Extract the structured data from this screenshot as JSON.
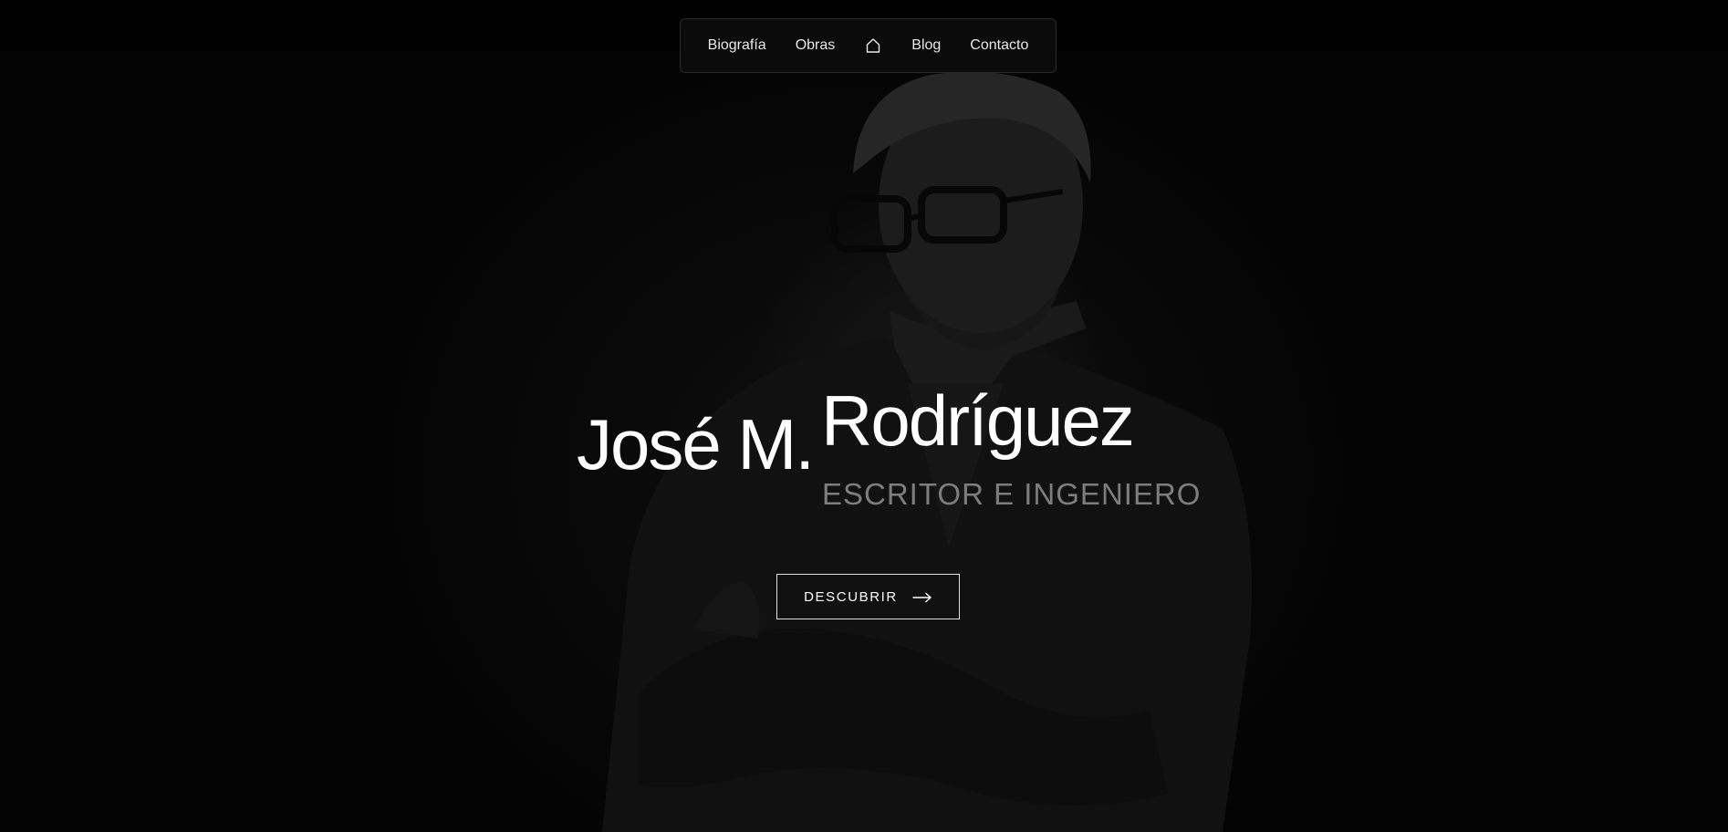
{
  "nav": {
    "items": [
      {
        "label": "Biografía"
      },
      {
        "label": "Obras"
      },
      {
        "icon": "home-icon"
      },
      {
        "label": "Blog"
      },
      {
        "label": "Contacto"
      }
    ]
  },
  "hero": {
    "first_name": "José M.",
    "last_name": "Rodríguez",
    "tagline": "ESCRITOR E INGENIERO",
    "cta_label": "DESCUBRIR",
    "cta_icon": "arrow-right-icon"
  },
  "colors": {
    "background": "#000000",
    "text": "#ffffff",
    "tagline": "#7d7d7d",
    "nav_border": "#2a2a2a"
  }
}
